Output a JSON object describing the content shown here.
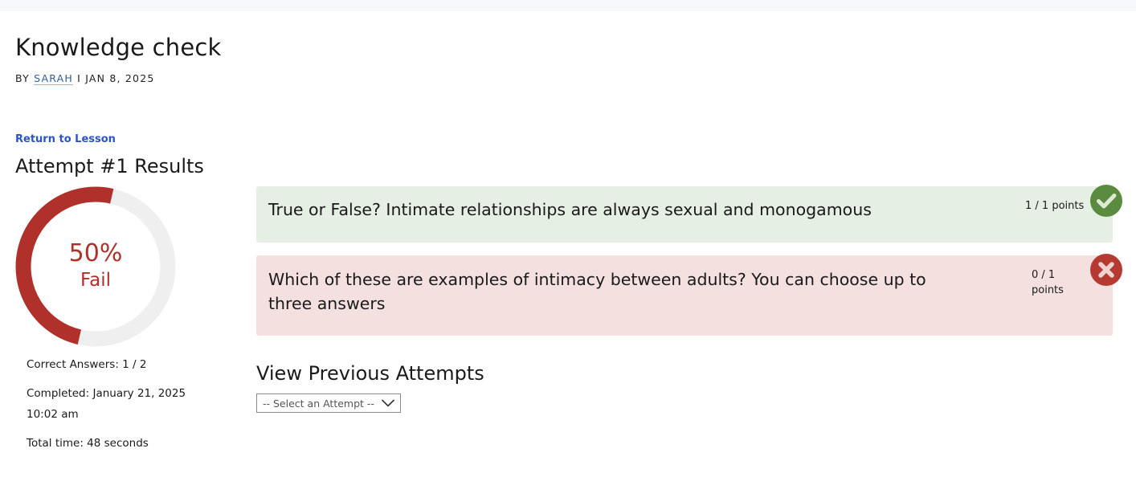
{
  "page": {
    "title": "Knowledge check",
    "byline_prefix": "BY",
    "author": "SARAH",
    "separator": "I",
    "date": "JAN 8, 2025"
  },
  "nav": {
    "return_link": "Return to Lesson"
  },
  "results": {
    "title": "Attempt #1 Results",
    "score_percent": "50%",
    "score_fraction": 0.5,
    "status": "Fail",
    "correct_answers": "Correct Answers: 1 / 2",
    "completed_line1": "Completed: January 21, 2025",
    "completed_line2": "10:02 am",
    "total_time": "Total time: 48 seconds"
  },
  "questions": [
    {
      "text": "True or False? Intimate relationships are always sexual and monogamous",
      "points": "1 / 1 points",
      "result": "correct",
      "icon": "checkmark-icon"
    },
    {
      "text_line1": "Which of these are examples of intimacy between adults? You can choose up to",
      "text_line2": "three answers",
      "points_line1": "0 / 1",
      "points_line2": "points",
      "result": "incorrect",
      "icon": "close-icon"
    }
  ],
  "previous_attempts": {
    "title": "View Previous Attempts",
    "select_value": "-- Select an Attempt --"
  },
  "colors": {
    "fail_red": "#b0312b",
    "correct_bg": "#e6efe4",
    "incorrect_bg": "#f3e0df",
    "correct_badge": "#5b8b3e",
    "incorrect_badge": "#b53a32",
    "link_blue": "#2a55c8"
  }
}
